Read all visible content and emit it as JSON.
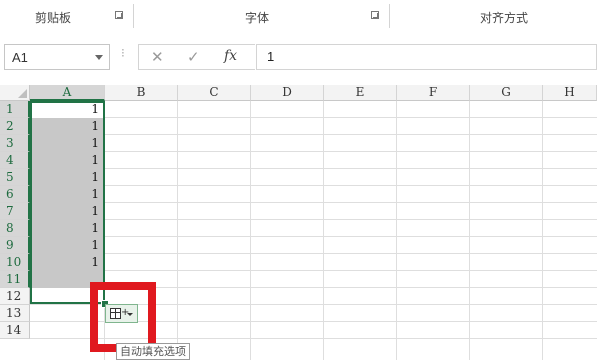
{
  "ribbon": {
    "groups": [
      {
        "label": "剪贴板"
      },
      {
        "label": "字体"
      },
      {
        "label": "对齐方式"
      }
    ]
  },
  "formula_bar": {
    "name_box": "A1",
    "cancel_icon": "close-icon",
    "enter_icon": "check-icon",
    "function_icon": "fx",
    "content": "1"
  },
  "grid": {
    "columns": [
      "A",
      "B",
      "C",
      "D",
      "E",
      "F",
      "G",
      "H"
    ],
    "rows": [
      "1",
      "2",
      "3",
      "4",
      "5",
      "6",
      "7",
      "8",
      "9",
      "10",
      "11",
      "12",
      "13",
      "14"
    ],
    "column_a_values": [
      "1",
      "1",
      "1",
      "1",
      "1",
      "1",
      "1",
      "1",
      "1",
      "1"
    ],
    "active_column": "A",
    "selected_rows": "1-11"
  },
  "autofill": {
    "tooltip": "自动填充选项"
  },
  "colors": {
    "selection_border": "#217346",
    "highlight_red": "#e0191f"
  }
}
